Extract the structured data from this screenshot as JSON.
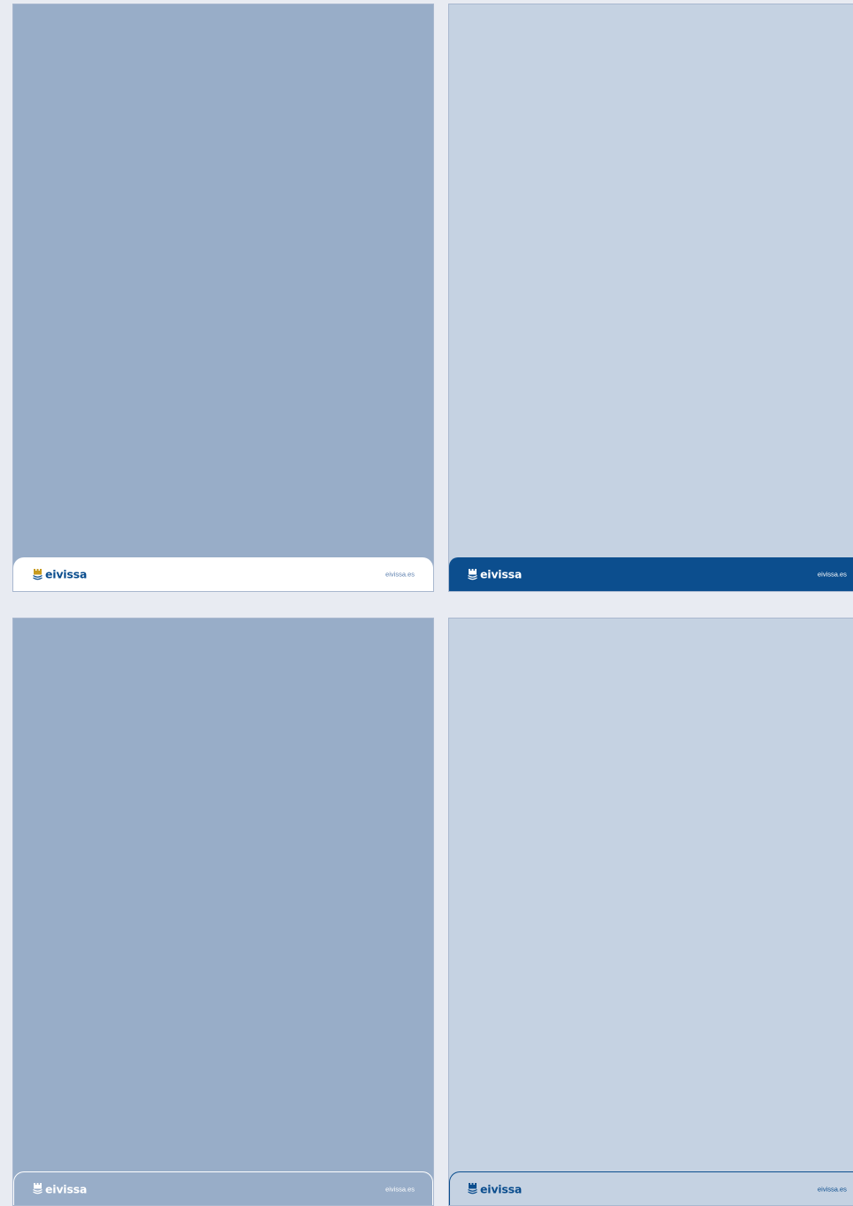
{
  "colors": {
    "page_background": "#e8ebf2",
    "panel_medium_blue": "#98adc8",
    "panel_light_blue": "#c5d2e2",
    "brand_dark_blue": "#0c4e8e",
    "white": "#ffffff",
    "emblem_gold": "#c79a1e"
  },
  "panels": [
    {
      "style": "white-rounded-footer",
      "brand": "eivissa",
      "site": "eivissa.es",
      "icon": "eivissa-emblem-icon"
    },
    {
      "style": "dark-blue-footer",
      "brand": "eivissa",
      "site": "eivissa.es",
      "icon": "eivissa-emblem-icon"
    },
    {
      "style": "transparent-outline-footer",
      "brand": "eivissa",
      "site": "eivissa.es",
      "icon": "eivissa-emblem-icon"
    },
    {
      "style": "outline-footer-dark-text",
      "brand": "eivissa",
      "site": "eivissa.es",
      "icon": "eivissa-emblem-icon"
    }
  ]
}
